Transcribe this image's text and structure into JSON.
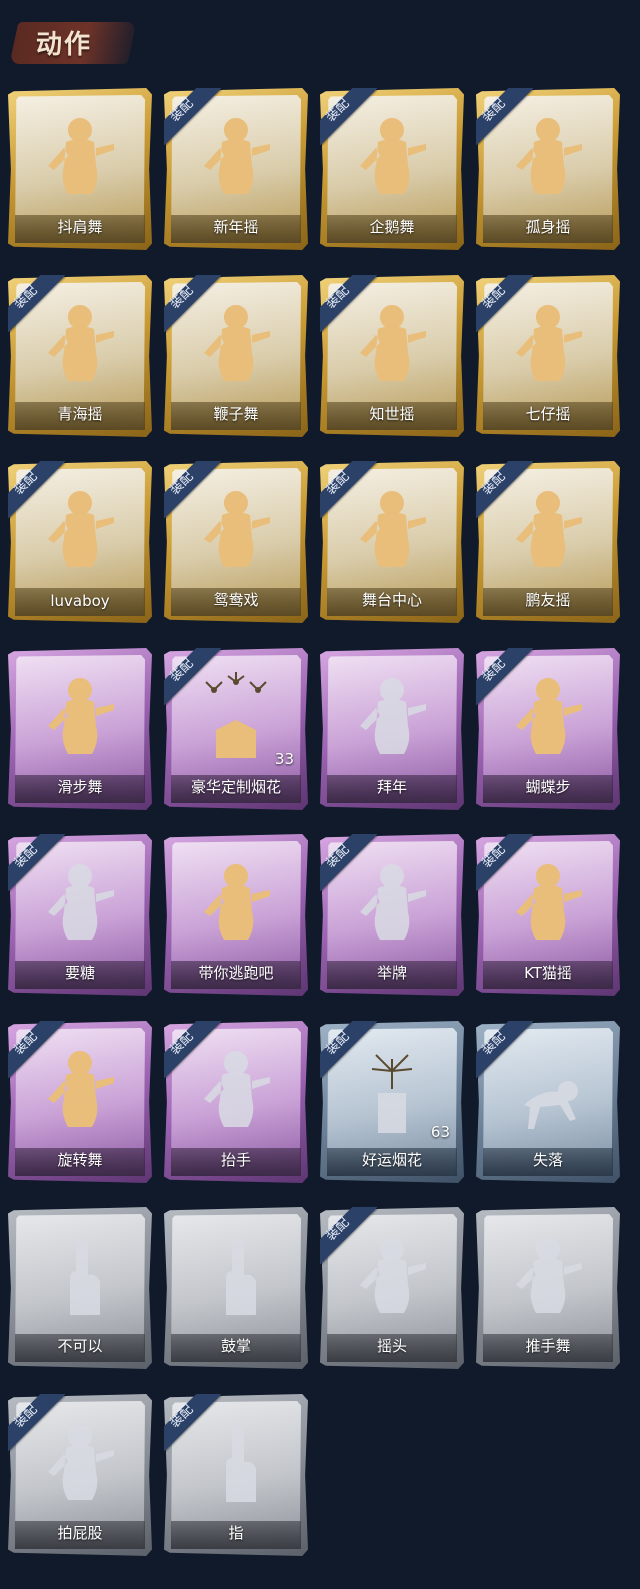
{
  "header": {
    "title": "动作"
  },
  "badge_text": "装配",
  "colors": {
    "gold": "#c99a33",
    "purple": "#9a62b0",
    "blue": "#6d8299",
    "grey": "#8a8f98",
    "badge": "#2c4168",
    "background": "#101a2b"
  },
  "items": [
    {
      "label": "抖肩舞",
      "tier": "gold",
      "equipped": false,
      "count": "",
      "icon": "dance-figure-icon",
      "ghost": false
    },
    {
      "label": "新年摇",
      "tier": "gold",
      "equipped": true,
      "count": "",
      "icon": "dance-figure-icon",
      "ghost": false
    },
    {
      "label": "企鹅舞",
      "tier": "gold",
      "equipped": true,
      "count": "",
      "icon": "dance-figure-icon",
      "ghost": false
    },
    {
      "label": "孤身摇",
      "tier": "gold",
      "equipped": true,
      "count": "",
      "icon": "dance-figure-icon",
      "ghost": false
    },
    {
      "label": "青海摇",
      "tier": "gold",
      "equipped": true,
      "count": "",
      "icon": "dance-figure-icon",
      "ghost": false
    },
    {
      "label": "鞭子舞",
      "tier": "gold",
      "equipped": true,
      "count": "",
      "icon": "dance-figure-icon",
      "ghost": false
    },
    {
      "label": "知世摇",
      "tier": "gold",
      "equipped": true,
      "count": "",
      "icon": "dance-figure-icon",
      "ghost": false
    },
    {
      "label": "七仔摇",
      "tier": "gold",
      "equipped": true,
      "count": "",
      "icon": "dance-figure-icon",
      "ghost": false
    },
    {
      "label": "luvaboy",
      "tier": "gold",
      "equipped": true,
      "count": "",
      "icon": "dance-figure-icon",
      "ghost": false
    },
    {
      "label": "鸳鸯戏",
      "tier": "gold",
      "equipped": true,
      "count": "",
      "icon": "dance-figure-icon",
      "ghost": false
    },
    {
      "label": "舞台中心",
      "tier": "gold",
      "equipped": true,
      "count": "",
      "icon": "dance-figure-icon",
      "ghost": false
    },
    {
      "label": "鹏友摇",
      "tier": "gold",
      "equipped": true,
      "count": "",
      "icon": "dance-figure-icon",
      "ghost": false
    },
    {
      "label": "滑步舞",
      "tier": "purple",
      "equipped": false,
      "count": "",
      "icon": "dance-figure-icon",
      "ghost": false
    },
    {
      "label": "豪华定制烟花",
      "tier": "purple",
      "equipped": true,
      "count": "33",
      "icon": "firework-box-icon",
      "ghost": false
    },
    {
      "label": "拜年",
      "tier": "purple",
      "equipped": false,
      "count": "",
      "icon": "greeting-figure-icon",
      "ghost": true
    },
    {
      "label": "蝴蝶步",
      "tier": "purple",
      "equipped": true,
      "count": "",
      "icon": "dance-figure-icon",
      "ghost": false
    },
    {
      "label": "要糖",
      "tier": "purple",
      "equipped": true,
      "count": "",
      "icon": "hand-out-figure-icon",
      "ghost": true
    },
    {
      "label": "带你逃跑吧",
      "tier": "purple",
      "equipped": false,
      "count": "",
      "icon": "dance-figure-icon",
      "ghost": false
    },
    {
      "label": "举牌",
      "tier": "purple",
      "equipped": true,
      "count": "",
      "icon": "sign-figure-icon",
      "ghost": true
    },
    {
      "label": "KT猫摇",
      "tier": "purple",
      "equipped": true,
      "count": "",
      "icon": "dance-figure-icon",
      "ghost": false
    },
    {
      "label": "旋转舞",
      "tier": "purple",
      "equipped": true,
      "count": "",
      "icon": "dance-figure-icon",
      "ghost": false
    },
    {
      "label": "抬手",
      "tier": "purple",
      "equipped": true,
      "count": "",
      "icon": "raise-hand-figure-icon",
      "ghost": true
    },
    {
      "label": "好运烟花",
      "tier": "blue",
      "equipped": true,
      "count": "63",
      "icon": "firework-tube-icon",
      "ghost": true
    },
    {
      "label": "失落",
      "tier": "blue",
      "equipped": true,
      "count": "",
      "icon": "crawling-figure-icon",
      "ghost": true
    },
    {
      "label": "不可以",
      "tier": "grey",
      "equipped": false,
      "count": "",
      "icon": "finger-wag-icon",
      "ghost": true
    },
    {
      "label": "鼓掌",
      "tier": "grey",
      "equipped": false,
      "count": "",
      "icon": "clapping-hands-icon",
      "ghost": true
    },
    {
      "label": "摇头",
      "tier": "grey",
      "equipped": true,
      "count": "",
      "icon": "shake-head-figure-icon",
      "ghost": true
    },
    {
      "label": "推手舞",
      "tier": "grey",
      "equipped": false,
      "count": "",
      "icon": "push-hands-figure-icon",
      "ghost": true
    },
    {
      "label": "拍屁股",
      "tier": "grey",
      "equipped": true,
      "count": "",
      "icon": "pat-figure-icon",
      "ghost": true
    },
    {
      "label": "指",
      "tier": "grey",
      "equipped": true,
      "count": "",
      "icon": "pointing-hand-icon",
      "ghost": true
    }
  ]
}
